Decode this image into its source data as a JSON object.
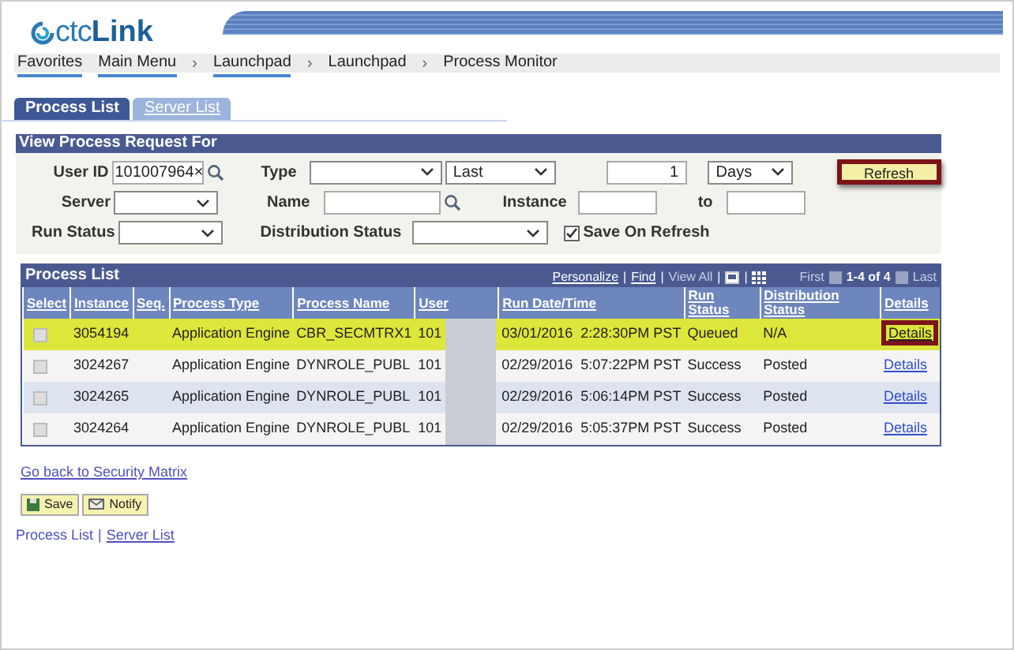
{
  "header": {
    "logo_prefix": "ctc",
    "logo_name": "Link"
  },
  "breadcrumbs": [
    {
      "label": "Favorites",
      "menu": true
    },
    {
      "label": "Main Menu",
      "menu": true
    },
    {
      "label": "Launchpad",
      "menu": true,
      "separator": "›"
    },
    {
      "label": "Launchpad",
      "menu": false,
      "separator": "›"
    },
    {
      "label": "Process Monitor",
      "menu": false,
      "separator": "›"
    }
  ],
  "tabs": [
    {
      "label": "Process List",
      "selected": true
    },
    {
      "label": "Server List",
      "selected": false
    }
  ],
  "filter": {
    "title": "View Process Request For",
    "user_id": {
      "label": "User ID",
      "value": "101007964",
      "clear": "×"
    },
    "type": {
      "label": "Type"
    },
    "period": {
      "value": "Last"
    },
    "amount": {
      "value": "1"
    },
    "unit": {
      "value": "Days"
    },
    "refresh": {
      "label": "Refresh",
      "highlighted": true
    },
    "server": {
      "label": "Server"
    },
    "name": {
      "label": "Name"
    },
    "instance": {
      "label": "Instance"
    },
    "to": {
      "label": "to"
    },
    "run_status": {
      "label": "Run Status"
    },
    "distribution_status": {
      "label": "Distribution Status"
    },
    "save_on_refresh": {
      "label": "Save On Refresh",
      "checked": true
    }
  },
  "process_list": {
    "title": "Process List",
    "nav": {
      "personalize": "Personalize",
      "find": "Find",
      "view_all": "View All",
      "separators": [
        "|",
        "|",
        "|",
        "|"
      ],
      "first": "First",
      "count": "1-4 of 4",
      "last": "Last"
    },
    "columns": [
      "Select",
      "Instance",
      "Seq.",
      "Process Type",
      "Process Name",
      "User",
      "Run Date/Time",
      "Run Status",
      "Distribution Status",
      "Details"
    ],
    "rows": [
      {
        "selected": true,
        "instance": "3054194",
        "process_type": "Application Engine",
        "process_name": "CBR_SECMTRX1",
        "user": "101",
        "run_date_time": "03/01/2016  2:28:30PM PST",
        "run_status": "Queued",
        "distribution_status": "N/A",
        "details": "Details",
        "details_highlighted": true
      },
      {
        "selected": false,
        "instance": "3024267",
        "process_type": "Application Engine",
        "process_name": "DYNROLE_PUBL",
        "user": "101",
        "run_date_time": "02/29/2016  5:07:22PM PST",
        "run_status": "Success",
        "distribution_status": "Posted",
        "details": "Details",
        "details_highlighted": false
      },
      {
        "selected": false,
        "instance": "3024265",
        "process_type": "Application Engine",
        "process_name": "DYNROLE_PUBL",
        "user": "101",
        "run_date_time": "02/29/2016  5:06:14PM PST",
        "run_status": "Success",
        "distribution_status": "Posted",
        "details": "Details",
        "details_highlighted": false
      },
      {
        "selected": false,
        "instance": "3024264",
        "process_type": "Application Engine",
        "process_name": "DYNROLE_PUBL",
        "user": "101",
        "run_date_time": "02/29/2016  5:05:37PM PST",
        "run_status": "Success",
        "distribution_status": "Posted",
        "details": "Details",
        "details_highlighted": false
      }
    ]
  },
  "back_link": "Go back to Security Matrix",
  "buttons": [
    {
      "kind": "save",
      "label": "Save"
    },
    {
      "kind": "notify",
      "label": "Notify"
    }
  ],
  "footer_links": [
    {
      "label": "Process List",
      "link": false
    },
    {
      "label": "Server List",
      "link": true,
      "separator": "|"
    }
  ]
}
